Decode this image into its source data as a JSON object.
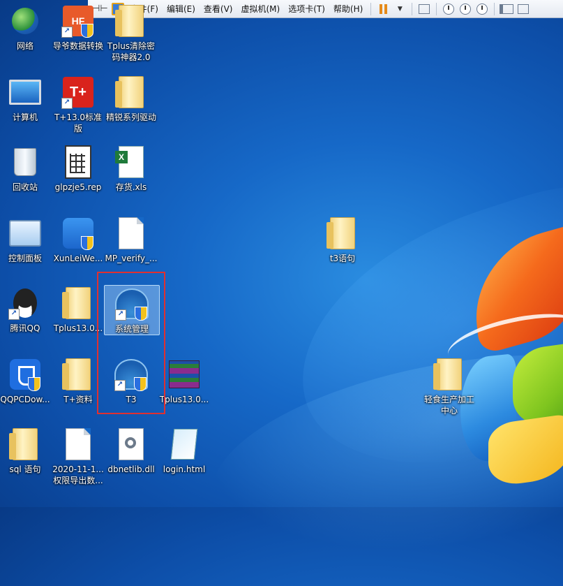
{
  "toolbar": {
    "menus": [
      "文件(F)",
      "编辑(E)",
      "查看(V)",
      "虚拟机(M)",
      "选项卡(T)",
      "帮助(H)"
    ]
  },
  "desktop": {
    "icons": [
      {
        "label": "网络",
        "icon": "network-icon"
      },
      {
        "label": "导爷数据转换",
        "icon": "shortcut-app-icon"
      },
      {
        "label": "Tplus清除密码神器2.0",
        "icon": "folder-icon"
      },
      {
        "label": "计算机",
        "icon": "computer-icon"
      },
      {
        "label": "T+13.0标准版",
        "icon": "tplus-icon"
      },
      {
        "label": "精锐系列驱动",
        "icon": "folder-icon"
      },
      {
        "label": "回收站",
        "icon": "recycle-bin-icon"
      },
      {
        "label": "glpzje5.rep",
        "icon": "report-file-icon"
      },
      {
        "label": "存货.xls",
        "icon": "excel-file-icon"
      },
      {
        "label": "控制面板",
        "icon": "control-panel-icon"
      },
      {
        "label": "XunLeiWe...",
        "icon": "xunlei-icon"
      },
      {
        "label": "MP_verify_...",
        "icon": "text-file-icon"
      },
      {
        "label": "t3语句",
        "icon": "folder-icon"
      },
      {
        "label": "腾讯QQ",
        "icon": "qq-icon"
      },
      {
        "label": "Tplus13.0...",
        "icon": "folder-icon"
      },
      {
        "label": "系统管理",
        "icon": "t3-admin-icon"
      },
      {
        "label": "QQPCDow...",
        "icon": "qq-pc-manager-icon"
      },
      {
        "label": "T+资料",
        "icon": "folder-icon"
      },
      {
        "label": "T3",
        "icon": "t3-icon"
      },
      {
        "label": "Tplus13.0...",
        "icon": "winrar-archive-icon"
      },
      {
        "label": "轻食生产加工中心",
        "icon": "folder-icon"
      },
      {
        "label": "sql 语句",
        "icon": "folder-icon"
      },
      {
        "label": "2020-11-1... 权限导出数...",
        "icon": "blank-file-icon"
      },
      {
        "label": "dbnetlib.dll",
        "icon": "dll-file-icon"
      },
      {
        "label": "login.html",
        "icon": "html-file-icon"
      }
    ]
  },
  "colors": {
    "desktop_bg": "#1668c7",
    "highlight_box": "#e03030",
    "selected_bg": "#aad2fa"
  }
}
